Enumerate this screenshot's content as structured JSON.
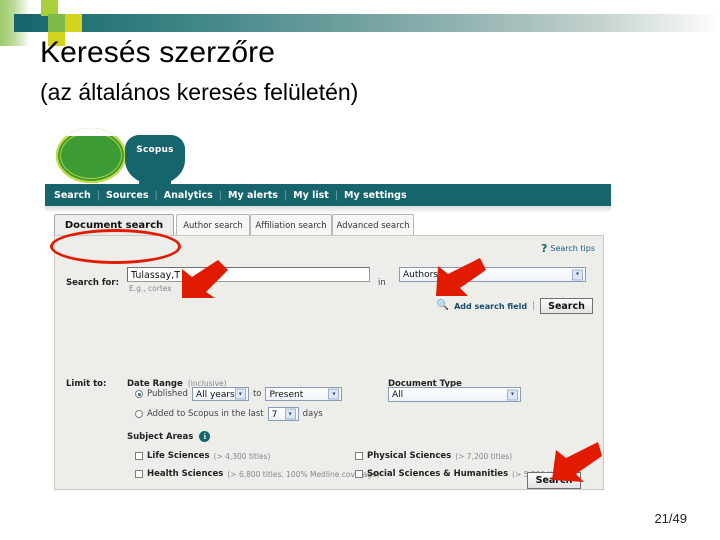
{
  "slide": {
    "title_line1": "Keresés szerzőre",
    "title_line2": "(az általános keresés felületén)",
    "page_indicator": "21/49"
  },
  "theme": {
    "teal": "#17656c",
    "green": "#3c9b35",
    "lime": "#a9cf3c",
    "yellow": "#d4d41f",
    "annotation_red": "#e01b00"
  },
  "screenshot": {
    "brand": {
      "logo_text": "Scopus",
      "logo_icon": "scopus-circle-logo"
    },
    "nav": {
      "items": [
        {
          "label": "Search"
        },
        {
          "label": "Sources"
        },
        {
          "label": "Analytics"
        },
        {
          "label": "My alerts"
        },
        {
          "label": "My list"
        },
        {
          "label": "My settings"
        }
      ],
      "separator": "|"
    },
    "tabs": [
      {
        "label": "Document search",
        "active": true
      },
      {
        "label": "Author search",
        "active": false
      },
      {
        "label": "Affiliation search",
        "active": false
      },
      {
        "label": "Advanced search",
        "active": false
      }
    ],
    "search_tips": {
      "icon": "question-mark-icon",
      "label": "Search tips"
    },
    "search_row": {
      "label": "Search for:",
      "query_value": "Tulassay,T",
      "query_hint": "E.g., cortex",
      "in_label": "in",
      "field_value": "Authors"
    },
    "actions": {
      "add_field_icon": "magnifier-plus-icon",
      "add_field_label": "Add search field",
      "divider": "|",
      "search_label": "Search"
    },
    "limit": {
      "label": "Limit to:",
      "date_range": {
        "title": "Date Range",
        "title_note": "(inclusive)",
        "published_label": "Published",
        "published_selected": true,
        "from_value": "All years",
        "to_label": "to",
        "to_value": "Present",
        "added_label_pre": "Added to Scopus in the last",
        "added_selected": false,
        "added_value": "7",
        "added_label_post": "days"
      },
      "document_type": {
        "title": "Document Type",
        "value": "All"
      }
    },
    "subject_areas": {
      "title": "Subject Areas",
      "info_icon": "info-icon",
      "items": [
        {
          "name": "Life Sciences",
          "note": "(> 4,300 titles)",
          "checked": true
        },
        {
          "name": "Physical Sciences",
          "note": "(> 7,200 titles)",
          "checked": true
        },
        {
          "name": "Health Sciences",
          "note": "(> 6,800 titles. 100% Medline coverage)",
          "checked": true
        },
        {
          "name": "Social Sciences & Humanities",
          "note": "(> 5,300 titles)",
          "checked": true
        }
      ]
    },
    "bottom_search_label": "Search"
  },
  "annotations": {
    "ellipse_target": "document-search-tab",
    "arrows": [
      {
        "points_to": "query-input"
      },
      {
        "points_to": "field-select"
      },
      {
        "points_to": "bottom-search-button"
      }
    ]
  }
}
